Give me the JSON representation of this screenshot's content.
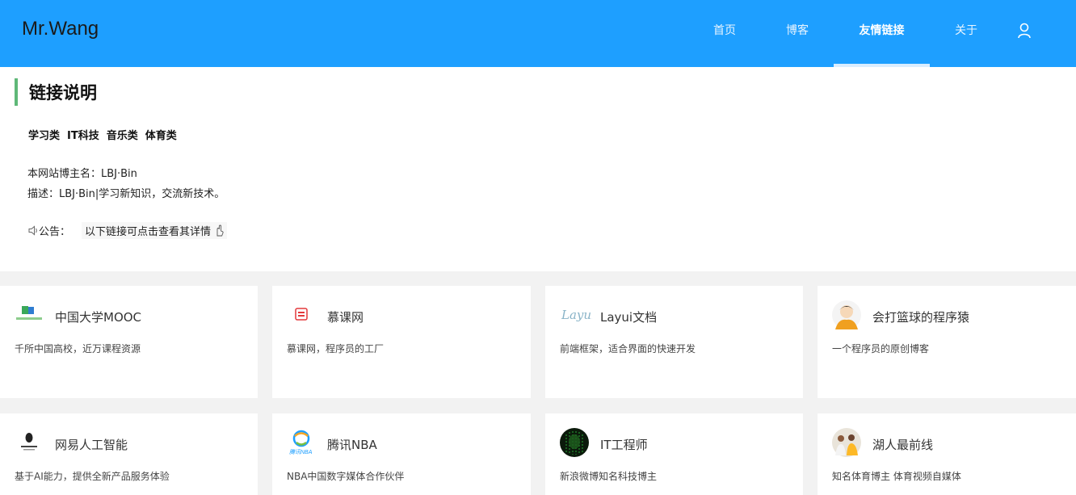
{
  "header": {
    "logo": "Mr.Wang",
    "nav": [
      {
        "label": "首页",
        "active": false
      },
      {
        "label": "博客",
        "active": false
      },
      {
        "label": "友情链接",
        "active": true
      },
      {
        "label": "关于",
        "active": false
      }
    ],
    "user_icon": "user-icon",
    "bg_color": "#1e9fff"
  },
  "intro": {
    "title": "链接说明",
    "categories": [
      "学习类",
      "IT科技",
      "音乐类",
      "体育类"
    ],
    "owner": "本网站博主名：LBJ·Bin",
    "description": "描述：LBJ·Bin|学习新知识，交流新技术。",
    "notice_label": "公告：",
    "notice_text": "以下链接可点击查看其详情",
    "accent_color": "#5fb878"
  },
  "links": [
    {
      "name": "中国大学MOOC",
      "desc": "千所中国高校，近万课程资源",
      "icon": "mooc-logo"
    },
    {
      "name": "慕课网",
      "desc": "慕课网，程序员的工厂",
      "icon": "imooc-logo"
    },
    {
      "name": "Layui文档",
      "desc": "前端框架，适合界面的快速开发",
      "icon": "layui-logo"
    },
    {
      "name": "会打篮球的程序猿",
      "desc": "一个程序员的原创博客",
      "icon": "avatar-icon"
    },
    {
      "name": "网易人工智能",
      "desc": "基于AI能力，提供全新产品服务体验",
      "icon": "netease-ai-logo"
    },
    {
      "name": "腾讯NBA",
      "desc": "NBA中国数字媒体合作伙伴",
      "icon": "tencent-nba-logo"
    },
    {
      "name": "IT工程师",
      "desc": "新浪微博知名科技博主",
      "icon": "it-engineer-avatar"
    },
    {
      "name": "湖人最前线",
      "desc": "知名体育博主 体育视频自媒体",
      "icon": "lakers-avatar"
    }
  ]
}
